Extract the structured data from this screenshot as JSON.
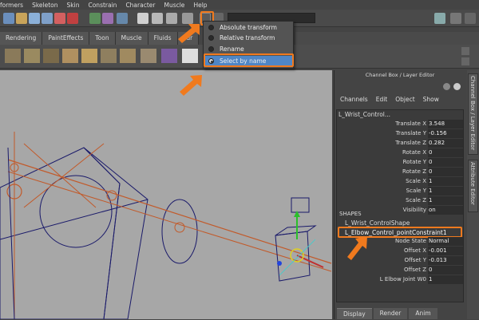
{
  "menubar": {
    "items": [
      "formers",
      "Skeleton",
      "Skin",
      "Constrain",
      "Character",
      "Muscle",
      "Help"
    ]
  },
  "shelf": {
    "tabs": [
      "Rendering",
      "PaintEffects",
      "Toon",
      "Muscle",
      "Fluids",
      "Fur"
    ]
  },
  "dropdown": {
    "items": [
      {
        "label": "Absolute transform",
        "selected": false
      },
      {
        "label": "Relative transform",
        "selected": false
      },
      {
        "label": "Rename",
        "selected": false
      },
      {
        "label": "Select by name",
        "selected": true
      }
    ]
  },
  "channel_box": {
    "title": "Channel Box / Layer Editor",
    "menu": [
      "Channels",
      "Edit",
      "Object",
      "Show"
    ],
    "object_name": "L_Wrist_Control...",
    "attributes": [
      {
        "label": "Translate X",
        "value": "3.548"
      },
      {
        "label": "Translate Y",
        "value": "-0.156"
      },
      {
        "label": "Translate Z",
        "value": "0.282"
      },
      {
        "label": "Rotate X",
        "value": "0"
      },
      {
        "label": "Rotate Y",
        "value": "0"
      },
      {
        "label": "Rotate Z",
        "value": "0"
      },
      {
        "label": "Scale X",
        "value": "1"
      },
      {
        "label": "Scale Y",
        "value": "1"
      },
      {
        "label": "Scale Z",
        "value": "1"
      },
      {
        "label": "Visibility",
        "value": "on"
      }
    ],
    "shapes_heading": "SHAPES",
    "shape_name": "L_Wrist_ControlShape",
    "constraint_name": "L_Elbow_Control_pointConstraint1",
    "constraint_attributes": [
      {
        "label": "Node State",
        "value": "Normal"
      },
      {
        "label": "Offset X",
        "value": "-0.001"
      },
      {
        "label": "Offset Y",
        "value": "-0.013"
      },
      {
        "label": "Offset Z",
        "value": "0"
      },
      {
        "label": "L Elbow Joint W0",
        "value": "1"
      }
    ],
    "bottom_tabs": [
      "Display",
      "Render",
      "Anim"
    ],
    "side_tabs": [
      "Channel Box / Layer Editor",
      "Attribute Editor"
    ]
  },
  "colors": {
    "highlight": "#f07a1e",
    "selected_menu": "#4f86c6",
    "viewport_bg": "#a7a7a7"
  }
}
